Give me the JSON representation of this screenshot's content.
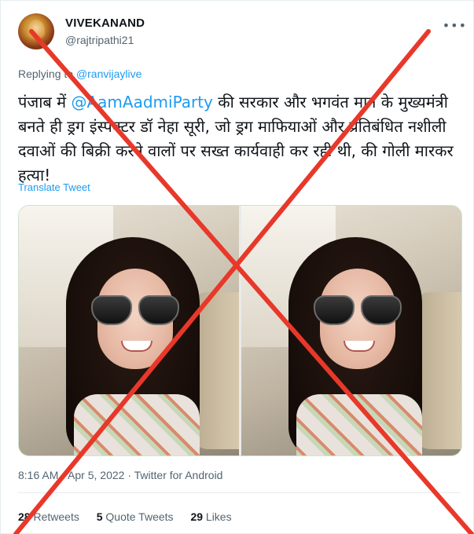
{
  "author": {
    "display_name": "VIVEKANAND",
    "handle": "@rajtripathi21"
  },
  "more_icon": "more-horizontal-icon",
  "reply": {
    "prefix": "Replying to",
    "mention": "@ranvijaylive"
  },
  "tweet": {
    "text_1": "पंजाब में ",
    "mention": "@AamAadmiParty",
    "text_2": " की सरकार और भगवंत मान के मुख्यमंत्री बनते ही ड्रग इंस्पेक्टर डॉ नेहा सूरी, जो ड्रग माफियाओं और प्रतिबंधित नशीली दवाओं की बिक्री करने वालों पर सख्त कार्यवाही कर रही थी, की गोली मारकर हत्या!",
    "translate": "Translate Tweet"
  },
  "meta": {
    "time": "8:16 AM",
    "date": "Apr 5, 2022",
    "source": "Twitter for Android",
    "sep": " · "
  },
  "stats": {
    "retweets_count": "28",
    "retweets_label": "Retweets",
    "quotes_count": "5",
    "quotes_label": "Quote Tweets",
    "likes_count": "29",
    "likes_label": "Likes"
  },
  "overlay": {
    "color": "#e8382a"
  }
}
